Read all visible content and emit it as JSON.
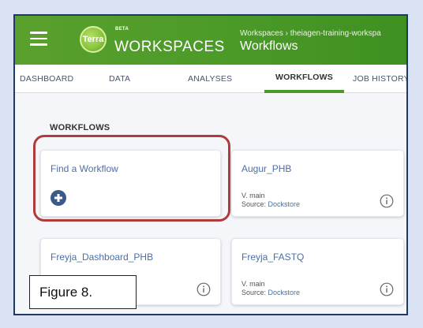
{
  "header": {
    "menu_icon": "hamburger-icon",
    "logo_text": "Terra",
    "beta": "BETA",
    "app_name": "WORKSPACES",
    "breadcrumb": "Workspaces › theiagen-training-workspa",
    "page_title": "Workflows",
    "accent": "#4b9a28"
  },
  "tabs": [
    {
      "label": "DASHBOARD",
      "active": false
    },
    {
      "label": "DATA",
      "active": false
    },
    {
      "label": "ANALYSES",
      "active": false
    },
    {
      "label": "WORKFLOWS",
      "active": true
    },
    {
      "label": "JOB HISTORY",
      "active": false
    }
  ],
  "workflows": {
    "section_title": "WORKFLOWS",
    "find_card": {
      "title": "Find a Workflow",
      "icon": "plus-circle-icon"
    },
    "cards": [
      {
        "title": "Augur_PHB",
        "version": "V. main",
        "source_label": "Source:",
        "source": "Dockstore"
      },
      {
        "title": "Freyja_Dashboard_PHB"
      },
      {
        "title": "Freyja_FASTQ",
        "version": "V. main",
        "source_label": "Source:",
        "source": "Dockstore"
      }
    ]
  },
  "annotation": {
    "figure_label": "Figure 8.",
    "highlight_color": "#b13a3a"
  }
}
